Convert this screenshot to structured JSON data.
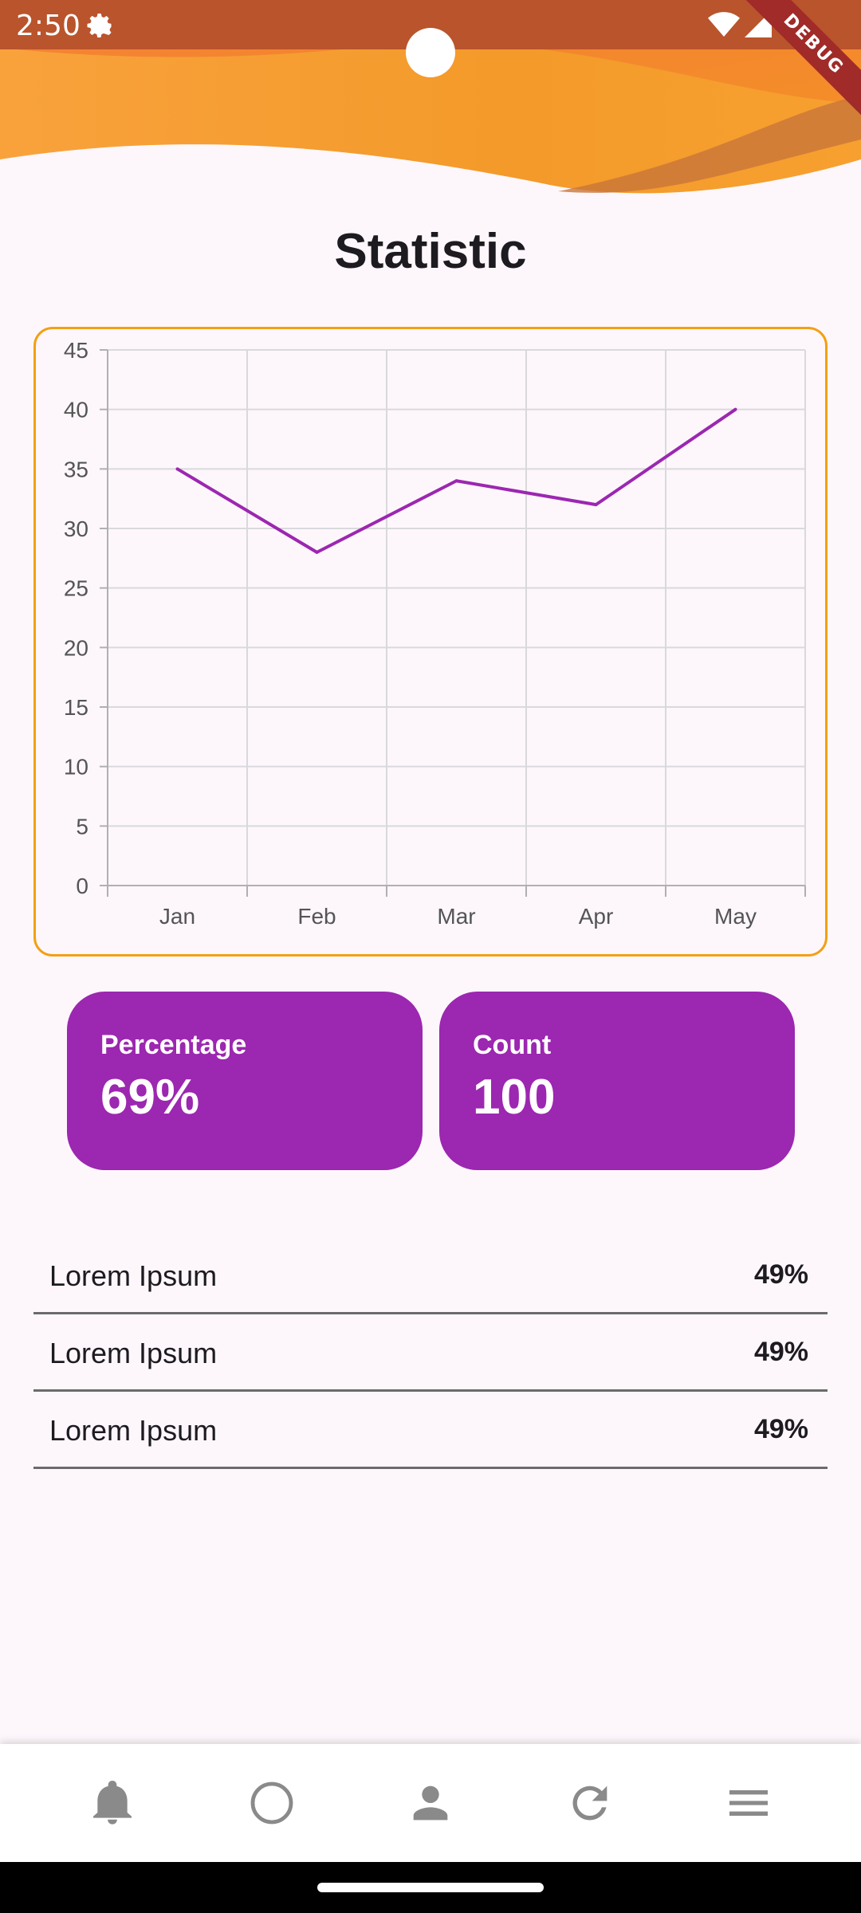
{
  "status_bar": {
    "time": "2:50"
  },
  "debug_banner": "DEBUG",
  "page": {
    "title": "Statistic"
  },
  "chart_data": {
    "type": "line",
    "title": "",
    "categories": [
      "Jan",
      "Feb",
      "Mar",
      "Apr",
      "May"
    ],
    "series": [
      {
        "values": [
          35,
          28,
          34,
          32,
          40
        ]
      }
    ],
    "yticks": [
      "0",
      "5",
      "10",
      "15",
      "20",
      "25",
      "30",
      "35",
      "40",
      "45"
    ],
    "ylim": [
      0,
      45
    ],
    "grid": true,
    "line_color": "#9c27b0"
  },
  "stats": [
    {
      "label": "Percentage",
      "value": "69%"
    },
    {
      "label": "Count",
      "value": "100"
    }
  ],
  "list": [
    {
      "name": "Lorem Ipsum",
      "value": "49%"
    },
    {
      "name": "Lorem Ipsum",
      "value": "49%"
    },
    {
      "name": "Lorem Ipsum",
      "value": "49%"
    }
  ],
  "bottom_nav": {
    "icons": [
      "bell-icon",
      "circle-icon",
      "person-icon",
      "refresh-icon",
      "menu-icon"
    ]
  },
  "colors": {
    "accent_purple": "#9c27b0",
    "chart_border": "#f2a014",
    "header_orange": "#f5892f"
  }
}
